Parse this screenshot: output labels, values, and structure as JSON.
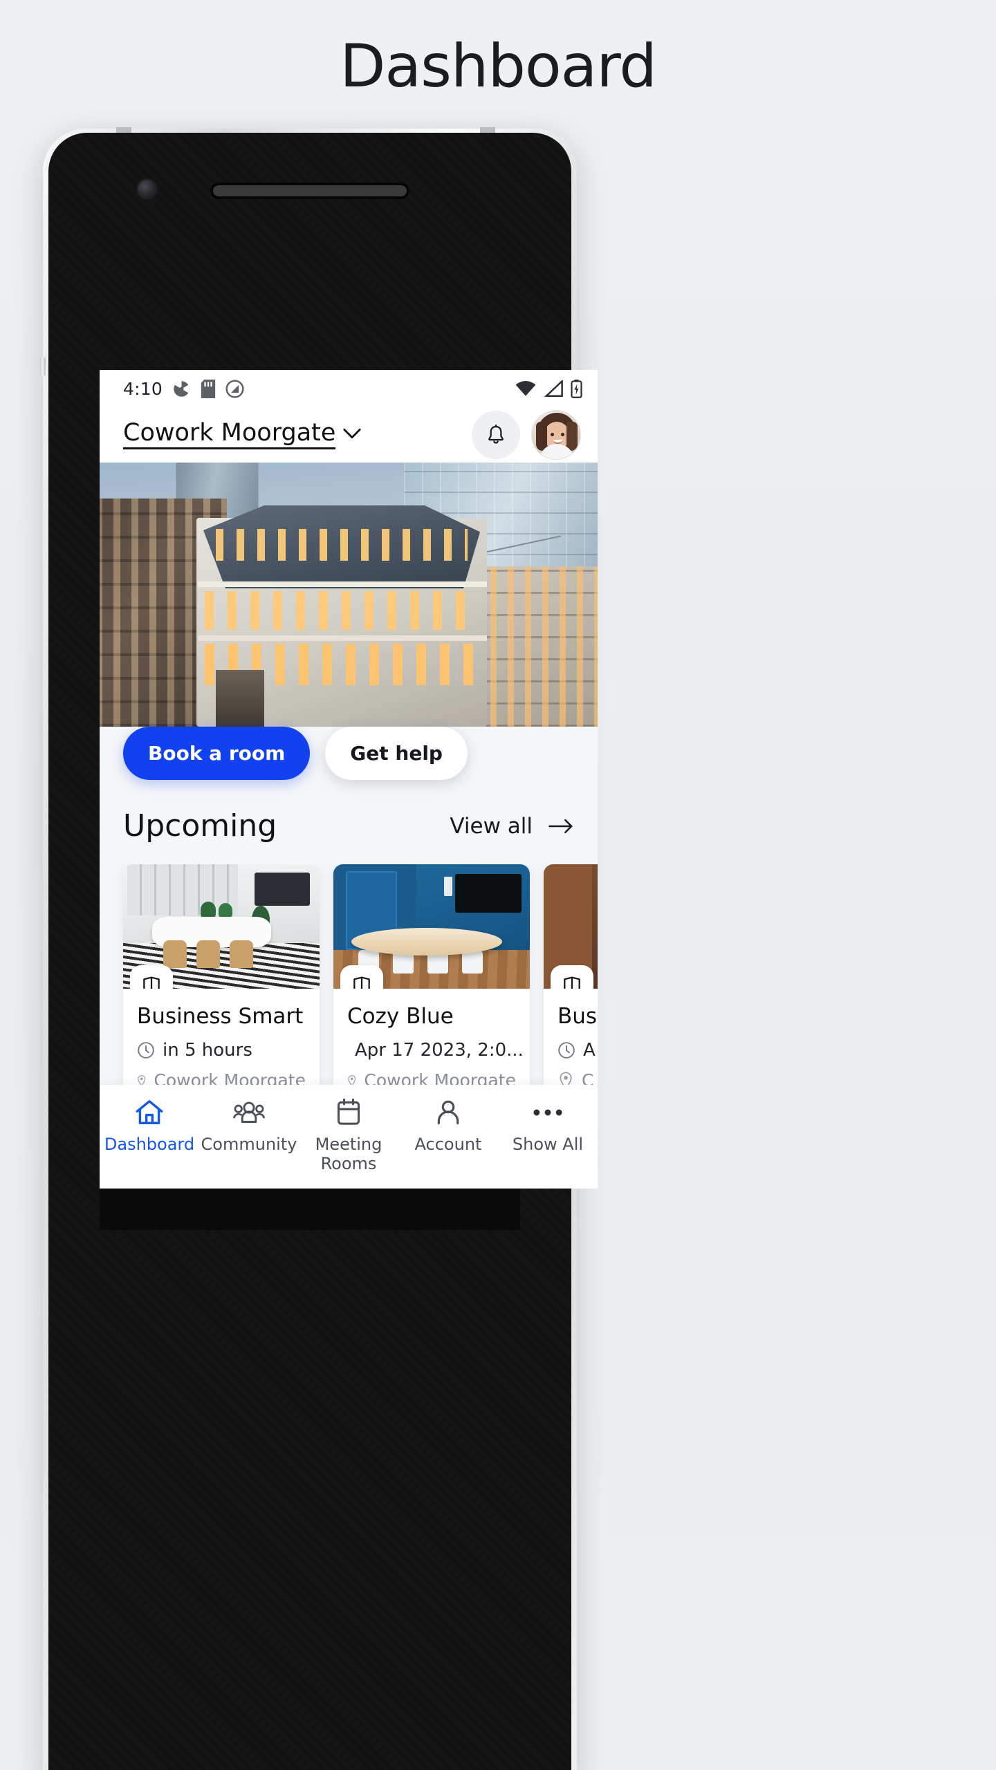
{
  "page": {
    "title": "Dashboard"
  },
  "status_bar": {
    "time": "4:10",
    "left_icons": [
      "sync-icon",
      "sd-card-icon",
      "do-not-disturb-icon"
    ],
    "right_icons": [
      "wifi-icon",
      "cellular-signal-icon",
      "battery-charging-icon"
    ]
  },
  "app_bar": {
    "venue_name": "Cowork Moorgate",
    "chevron": "chevron-down-icon",
    "notifications": "bell-icon",
    "avatar": "user-avatar"
  },
  "hero": {
    "cta_primary": "Book a room",
    "cta_secondary": "Get help"
  },
  "upcoming": {
    "title": "Upcoming",
    "view_all": "View all",
    "view_all_arrow": "arrow-right-icon",
    "cards": [
      {
        "title": "Business Smart",
        "time": "in 5 hours",
        "location": "Cowork Moorgate",
        "badge": "door-icon"
      },
      {
        "title": "Cozy Blue",
        "time": "Apr 17 2023, 2:0...",
        "location": "Cowork Moorgate",
        "badge": "door-icon"
      },
      {
        "title": "Bus",
        "time": "A",
        "location": "C",
        "badge": "door-icon"
      }
    ]
  },
  "bottom_nav": {
    "active_index": 0,
    "items": [
      {
        "label": "Dashboard",
        "icon": "home-icon"
      },
      {
        "label": "Community",
        "icon": "people-icon"
      },
      {
        "label": "Meeting Rooms",
        "icon": "calendar-icon"
      },
      {
        "label": "Account",
        "icon": "person-icon"
      },
      {
        "label": "Show All",
        "icon": "ellipsis-icon"
      }
    ]
  },
  "colors": {
    "accent": "#1241ef",
    "nav_active": "#1458e8",
    "page_bg": "#eceff1",
    "screen_bg": "#f4f6f8"
  }
}
